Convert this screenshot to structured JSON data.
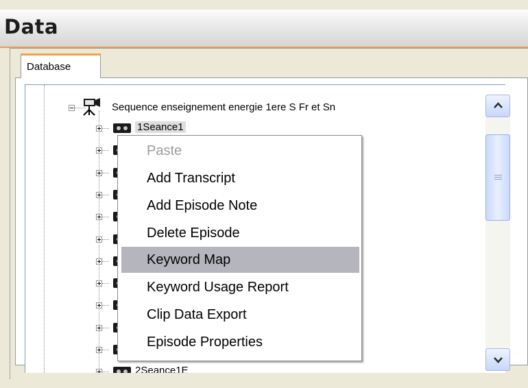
{
  "window": {
    "title": "Data"
  },
  "tabs": [
    {
      "label": "Database"
    }
  ],
  "tree": {
    "root": {
      "label": "Sequence enseignement energie 1ere S Fr et Sn",
      "icon": "video-camera-icon"
    },
    "episodes": [
      {
        "label": "1Seance1",
        "selected": true
      },
      {
        "label": ""
      },
      {
        "label": ""
      },
      {
        "label": ""
      },
      {
        "label": ""
      },
      {
        "label": ""
      },
      {
        "label": ""
      },
      {
        "label": ""
      },
      {
        "label": ""
      },
      {
        "label": ""
      },
      {
        "label": ""
      },
      {
        "label": "2Seance1E"
      }
    ]
  },
  "context_menu": {
    "items": [
      {
        "label": "Paste",
        "disabled": true
      },
      {
        "label": "Add Transcript"
      },
      {
        "label": "Add Episode Note"
      },
      {
        "label": "Delete Episode"
      },
      {
        "label": "Keyword Map",
        "highlighted": true
      },
      {
        "label": "Keyword Usage Report"
      },
      {
        "label": "Clip Data Export"
      },
      {
        "label": "Episode Properties"
      }
    ]
  },
  "scrollbar": {
    "up_icon": "arrow-up-icon",
    "down_icon": "arrow-down-icon"
  }
}
